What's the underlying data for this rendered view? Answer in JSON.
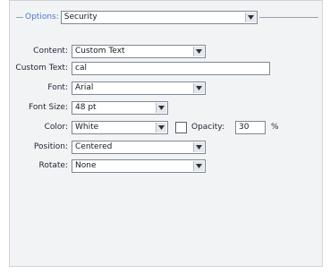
{
  "legend": {
    "label": "Options:",
    "selected": "Security"
  },
  "rows": {
    "content": {
      "label": "Content:",
      "value": "Custom Text"
    },
    "custom_text": {
      "label": "Custom Text:",
      "value": "cal"
    },
    "font": {
      "label": "Font:",
      "value": "Arial"
    },
    "font_size": {
      "label": "Font Size:",
      "value": "48 pt"
    },
    "color": {
      "label": "Color:",
      "value": "White"
    },
    "opacity": {
      "label": "Opacity:",
      "value": "30",
      "unit": "%"
    },
    "position": {
      "label": "Position:",
      "value": "Centered"
    },
    "rotate": {
      "label": "Rotate:",
      "value": "None"
    }
  },
  "icons": {
    "dropdown": "chevron-down-icon"
  },
  "colors": {
    "accent": "#4a78c4",
    "panel": "#f2f3f5",
    "border": "#7e8893"
  }
}
